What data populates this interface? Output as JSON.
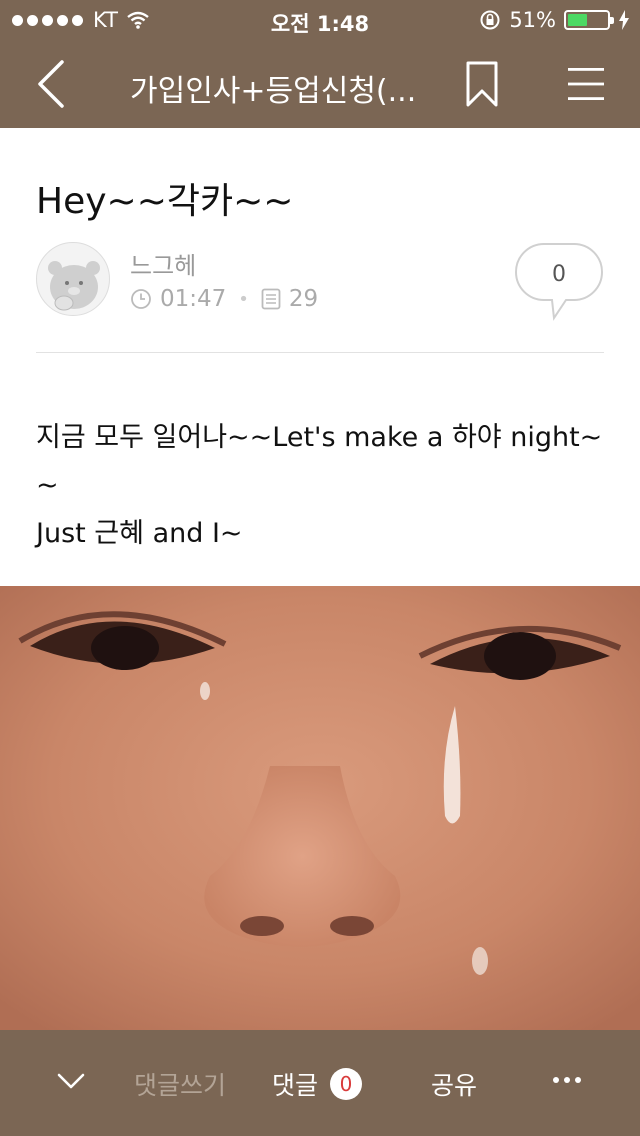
{
  "status_bar": {
    "carrier": "KT",
    "time": "오전 1:48",
    "battery_percent": "51%",
    "battery_level": 0.51
  },
  "nav": {
    "title": "가입인사+등업신청(..."
  },
  "post": {
    "title": "Hey~~각카~~",
    "author": "느그헤",
    "time": "01:47",
    "views": "29",
    "comment_count": "0",
    "body_lines": [
      "지금 모두 일어나~~Let's make a 하야 night~",
      "~",
      "Just 근혜 and I~"
    ]
  },
  "bottom_bar": {
    "write_comment": "댓글쓰기",
    "comments_label": "댓글",
    "comments_badge": "0",
    "share": "공유"
  },
  "colors": {
    "brand": "#7b6654",
    "battery_fill": "#4cd964",
    "badge_text": "#d93b3b"
  }
}
